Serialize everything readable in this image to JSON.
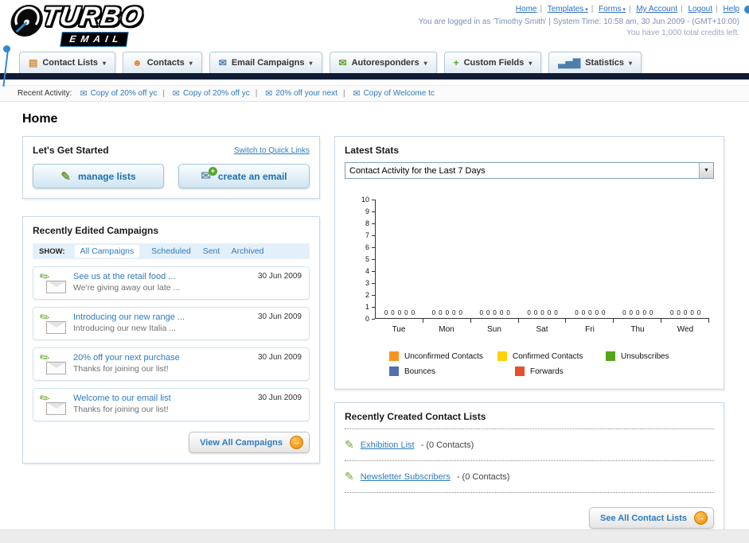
{
  "header": {
    "logo": {
      "line1": "TURBO",
      "line2": "EMAIL"
    },
    "nav_links": [
      {
        "label": "Home",
        "dropdown": false
      },
      {
        "label": "Templates",
        "dropdown": true
      },
      {
        "label": "Forms",
        "dropdown": true
      },
      {
        "label": "My Account",
        "dropdown": false
      },
      {
        "label": "Logout",
        "dropdown": false
      },
      {
        "label": "Help",
        "dropdown": false
      }
    ],
    "login_status": "You are logged in as 'Timothy Smith' | System Time: 10:58 am, 30 Jun 2009 - (GMT+10:00)",
    "credits": "You have 1,000 total credits left."
  },
  "tabs": [
    {
      "label": "Contact Lists",
      "icon": "contact-lists-icon",
      "glyph": "▤",
      "color": "#e0882a"
    },
    {
      "label": "Contacts",
      "icon": "contacts-icon",
      "glyph": "☻",
      "color": "#e0882a"
    },
    {
      "label": "Email Campaigns",
      "icon": "email-campaigns-icon",
      "glyph": "✉",
      "color": "#4a7fae"
    },
    {
      "label": "Autoresponders",
      "icon": "autoresponders-icon",
      "glyph": "✉",
      "color": "#57a829"
    },
    {
      "label": "Custom Fields",
      "icon": "custom-fields-icon",
      "glyph": "+",
      "color": "#57a829"
    },
    {
      "label": "Statistics",
      "icon": "statistics-icon",
      "glyph": "▃▅▇",
      "color": "#4a7fae"
    }
  ],
  "recent_activity": {
    "label": "Recent Activity:",
    "items": [
      "Copy of 20% off yc",
      "Copy of 20% off yc",
      "20% off your next",
      "Copy of Welcome tc"
    ]
  },
  "page_title": "Home",
  "get_started": {
    "title": "Let's Get Started",
    "switch_link": "Switch to Quick Links",
    "manage_lists": "manage lists",
    "create_email": "create an email"
  },
  "campaigns": {
    "title": "Recently Edited Campaigns",
    "show_label": "SHOW:",
    "filters": [
      {
        "label": "All Campaigns",
        "selected": true
      },
      {
        "label": "Scheduled",
        "selected": false
      },
      {
        "label": "Sent",
        "selected": false
      },
      {
        "label": "Archived",
        "selected": false
      }
    ],
    "items": [
      {
        "title": "See us at the retail food ...",
        "subtitle": "We're giving away our late ...",
        "date": "30 Jun 2009"
      },
      {
        "title": "Introducing our new range ...",
        "subtitle": "Introducing our new Italia ...",
        "date": "30 Jun 2009"
      },
      {
        "title": "20% off your next purchase",
        "subtitle": "Thanks for joining our list!",
        "date": "30 Jun 2009"
      },
      {
        "title": "Welcome to our email list",
        "subtitle": "Thanks for joining our list!",
        "date": "30 Jun 2009"
      }
    ],
    "view_all_label": "View All Campaigns"
  },
  "stats": {
    "title": "Latest Stats",
    "period_selected": "Contact Activity for the Last 7 Days",
    "chart_data": {
      "type": "bar",
      "categories": [
        "Tue",
        "Mon",
        "Sun",
        "Sat",
        "Fri",
        "Thu",
        "Wed"
      ],
      "series": [
        {
          "name": "Unconfirmed Contacts",
          "color": "#f7941d",
          "values": [
            0,
            0,
            0,
            0,
            0,
            0,
            0
          ]
        },
        {
          "name": "Confirmed Contacts",
          "color": "#ffd200",
          "values": [
            0,
            0,
            0,
            0,
            0,
            0,
            0
          ]
        },
        {
          "name": "Unsubscribes",
          "color": "#55a51c",
          "values": [
            0,
            0,
            0,
            0,
            0,
            0,
            0
          ]
        },
        {
          "name": "Bounces",
          "color": "#4f6fb0",
          "values": [
            0,
            0,
            0,
            0,
            0,
            0,
            0
          ]
        },
        {
          "name": "Forwards",
          "color": "#e8502a",
          "values": [
            0,
            0,
            0,
            0,
            0,
            0,
            0
          ]
        }
      ],
      "ylim": [
        0,
        10
      ],
      "y_step": 1,
      "legend_rows": [
        3,
        2
      ]
    }
  },
  "contact_lists": {
    "title": "Recently Created Contact Lists",
    "items": [
      {
        "name": "Exhibition List",
        "count": "- (0 Contacts)"
      },
      {
        "name": "Newsletter Subscribers",
        "count": "- (0 Contacts)"
      }
    ],
    "see_all_label": "See All Contact Lists"
  }
}
